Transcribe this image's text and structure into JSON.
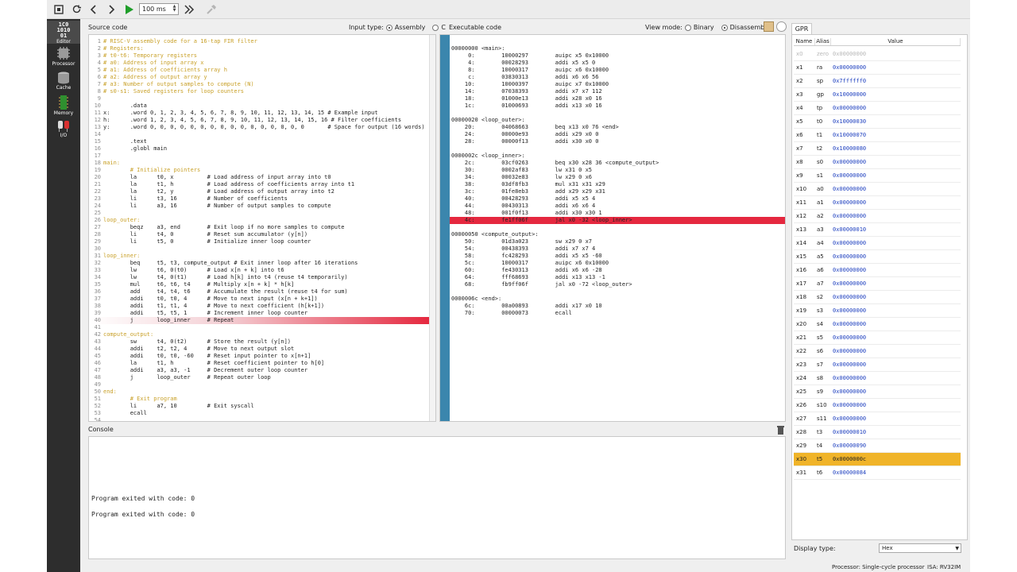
{
  "toolbar": {
    "speed_value": "100 ms",
    "icons": [
      "reset-icon",
      "reload-icon",
      "step-back-icon",
      "step-forward-icon",
      "run-icon",
      "fast-forward-icon",
      "hammer-icon"
    ]
  },
  "sidebar": {
    "items": [
      {
        "label": "Editor",
        "icon": "editor-icon"
      },
      {
        "label": "Processor",
        "icon": "processor-icon"
      },
      {
        "label": "Cache",
        "icon": "cache-icon"
      },
      {
        "label": "Memory",
        "icon": "memory-icon"
      },
      {
        "label": "I/O",
        "icon": "io-icon"
      }
    ],
    "editor_glyph": "1C0\n1010\n01"
  },
  "source": {
    "title": "Source code",
    "input_type_label": "Input type:",
    "option_assembly": "Assembly",
    "option_c": "C",
    "lines": [
      "# RISC-V assembly code for a 16-tap FIR filter",
      "# Registers:",
      "# t0-t6: Temporary registers",
      "# a0: Address of input array x",
      "# a1: Address of coefficients array h",
      "# a2: Address of output array y",
      "# a3: Number of output samples to compute (N)",
      "# s0-s1: Saved registers for loop counters",
      "",
      "        .data",
      "x:      .word 0, 1, 2, 3, 4, 5, 6, 7, 8, 9, 10, 11, 12, 13, 14, 15 # Example input",
      "h:      .word 1, 2, 3, 4, 5, 6, 7, 8, 9, 10, 11, 12, 13, 14, 15, 16 # Filter coefficients",
      "y:      .word 0, 0, 0, 0, 0, 0, 0, 0, 0, 0, 0, 0, 0, 0, 0, 0       # Space for output (16 words)",
      "",
      "        .text",
      "        .globl main",
      "",
      "main:",
      "        # Initialize pointers",
      "        la      t0, x          # Load address of input array into t0",
      "        la      t1, h          # Load address of coefficients array into t1",
      "        la      t2, y          # Load address of output array into t2",
      "        li      t3, 16         # Number of coefficients",
      "        li      a3, 16         # Number of output samples to compute",
      "",
      "loop_outer:",
      "        beqz    a3, end        # Exit loop if no more samples to compute",
      "        li      t4, 0          # Reset sum accumulator (y[n])",
      "        li      t5, 0          # Initialize inner loop counter",
      "",
      "loop_inner:",
      "        beq     t5, t3, compute_output # Exit inner loop after 16 iterations",
      "        lw      t6, 0(t0)      # Load x[n + k] into t6",
      "        lw      t4, 0(t1)      # Load h[k] into t4 (reuse t4 temporarily)",
      "        mul     t6, t6, t4     # Multiply x[n + k] * h[k]",
      "        add     t4, t4, t6     # Accumulate the result (reuse t4 for sum)",
      "        addi    t0, t0, 4      # Move to next input (x[n + k+1])",
      "        addi    t1, t1, 4      # Move to next coefficient (h[k+1])",
      "        addi    t5, t5, 1      # Increment inner loop counter",
      "        j       loop_inner     # Repeat",
      "",
      "compute_output:",
      "        sw      t4, 0(t2)      # Store the result (y[n])",
      "        addi    t2, t2, 4      # Move to next output slot",
      "        addi    t0, t0, -60    # Reset input pointer to x[n+1]",
      "        la      t1, h          # Reset coefficient pointer to h[0]",
      "        addi    a3, a3, -1     # Decrement outer loop counter",
      "        j       loop_outer     # Repeat outer loop",
      "",
      "end:",
      "        # Exit program",
      "        li      a7, 10         # Exit syscall",
      "        ecall",
      ""
    ],
    "highlight_line": 40
  },
  "executable": {
    "title": "Executable code",
    "view_mode_label": "View mode:",
    "option_binary": "Binary",
    "option_disassembled": "Disassembled",
    "lines": [
      "00000000 <main>:",
      "     0:        10000297        auipc x5 0x10000",
      "     4:        00028293        addi x5 x5 0",
      "     8:        10000317        auipc x6 0x10000",
      "     c:        03830313        addi x6 x6 56",
      "    10:        10000397        auipc x7 0x10000",
      "    14:        07038393        addi x7 x7 112",
      "    18:        01000e13        addi x28 x0 16",
      "    1c:        01000693        addi x13 x0 16",
      "",
      "00000020 <loop_outer>:",
      "    20:        04068663        beq x13 x0 76 <end>",
      "    24:        00000e93        addi x29 x0 0",
      "    28:        00000f13        addi x30 x0 0",
      "",
      "0000002c <loop_inner>:",
      "    2c:        03cf0263        beq x30 x28 36 <compute_output>",
      "    30:        0002af83        lw x31 0 x5",
      "    34:        00032e83        lw x29 0 x6",
      "    38:        03df8fb3        mul x31 x31 x29",
      "    3c:        01fe8eb3        add x29 x29 x31",
      "    40:        00428293        addi x5 x5 4",
      "    44:        00430313        addi x6 x6 4",
      "    48:        001f0f13        addi x30 x30 1",
      "    4c:        fe1ff06f        jal x0 -32 <loop_inner>",
      "",
      "00000050 <compute_output>:",
      "    50:        01d3a023        sw x29 0 x7",
      "    54:        00438393        addi x7 x7 4",
      "    58:        fc428293        addi x5 x5 -60",
      "    5c:        10000317        auipc x6 0x10000",
      "    60:        fe430313        addi x6 x6 -28",
      "    64:        fff68693        addi x13 x13 -1",
      "    68:        fb9ff06f        jal x0 -72 <loop_outer>",
      "",
      "0000006c <end>:",
      "    6c:        00a00893        addi x17 x0 10",
      "    70:        00000073        ecall"
    ],
    "highlight_line": 24
  },
  "console": {
    "title": "Console",
    "lines": [
      "Program exited with code: 0",
      "Program exited with code: 0"
    ]
  },
  "gpr": {
    "tab": "GPR",
    "headers": [
      "Name",
      "Alias",
      "Value"
    ],
    "rows": [
      {
        "name": "x0",
        "alias": "zero",
        "value": "0x00000000"
      },
      {
        "name": "x1",
        "alias": "ra",
        "value": "0x00000000"
      },
      {
        "name": "x2",
        "alias": "sp",
        "value": "0x7ffffff0"
      },
      {
        "name": "x3",
        "alias": "gp",
        "value": "0x10000000"
      },
      {
        "name": "x4",
        "alias": "tp",
        "value": "0x00000000"
      },
      {
        "name": "x5",
        "alias": "t0",
        "value": "0x10000030"
      },
      {
        "name": "x6",
        "alias": "t1",
        "value": "0x10000070"
      },
      {
        "name": "x7",
        "alias": "t2",
        "value": "0x10000080"
      },
      {
        "name": "x8",
        "alias": "s0",
        "value": "0x00000000"
      },
      {
        "name": "x9",
        "alias": "s1",
        "value": "0x00000000"
      },
      {
        "name": "x10",
        "alias": "a0",
        "value": "0x00000000"
      },
      {
        "name": "x11",
        "alias": "a1",
        "value": "0x00000000"
      },
      {
        "name": "x12",
        "alias": "a2",
        "value": "0x00000000"
      },
      {
        "name": "x13",
        "alias": "a3",
        "value": "0x00000010"
      },
      {
        "name": "x14",
        "alias": "a4",
        "value": "0x00000000"
      },
      {
        "name": "x15",
        "alias": "a5",
        "value": "0x00000000"
      },
      {
        "name": "x16",
        "alias": "a6",
        "value": "0x00000000"
      },
      {
        "name": "x17",
        "alias": "a7",
        "value": "0x00000000"
      },
      {
        "name": "x18",
        "alias": "s2",
        "value": "0x00000000"
      },
      {
        "name": "x19",
        "alias": "s3",
        "value": "0x00000000"
      },
      {
        "name": "x20",
        "alias": "s4",
        "value": "0x00000000"
      },
      {
        "name": "x21",
        "alias": "s5",
        "value": "0x00000000"
      },
      {
        "name": "x22",
        "alias": "s6",
        "value": "0x00000000"
      },
      {
        "name": "x23",
        "alias": "s7",
        "value": "0x00000000"
      },
      {
        "name": "x24",
        "alias": "s8",
        "value": "0x00000000"
      },
      {
        "name": "x25",
        "alias": "s9",
        "value": "0x00000000"
      },
      {
        "name": "x26",
        "alias": "s10",
        "value": "0x00000000"
      },
      {
        "name": "x27",
        "alias": "s11",
        "value": "0x00000000"
      },
      {
        "name": "x28",
        "alias": "t3",
        "value": "0x00000010"
      },
      {
        "name": "x29",
        "alias": "t4",
        "value": "0x00000090"
      },
      {
        "name": "x30",
        "alias": "t5",
        "value": "0x0000000c"
      },
      {
        "name": "x31",
        "alias": "t6",
        "value": "0x00000084"
      }
    ],
    "highlight_row": 30,
    "display_type_label": "Display type:",
    "display_type_value": "Hex"
  },
  "status": {
    "processor": "Processor: Single-cycle processor",
    "isa": "ISA: RV32IM"
  },
  "colors": {
    "sidebar_bg": "#2d2d2d",
    "highlight_red": "#e5283f",
    "gutter_blue": "#3b86ad",
    "register_highlight": "#f0b429",
    "run_green": "#1f9e2a"
  }
}
